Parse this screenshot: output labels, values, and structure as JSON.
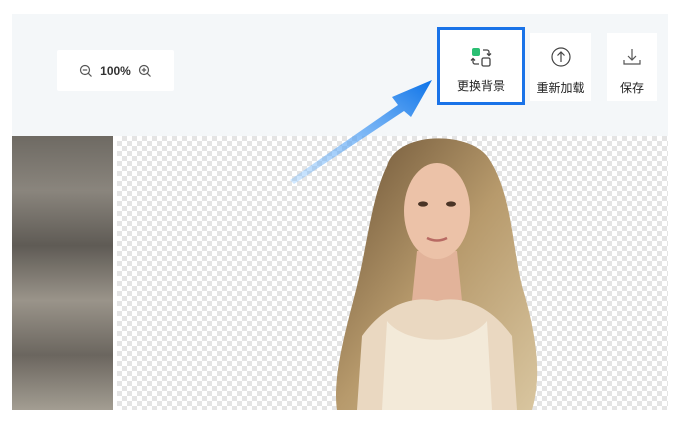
{
  "zoom": {
    "value": "100%",
    "out_icon": "zoom-out-icon",
    "in_icon": "zoom-in-icon"
  },
  "toolbar": {
    "change_background": {
      "label": "更换背景",
      "icon": "swap-background-icon"
    },
    "reload": {
      "label": "重新加载",
      "icon": "upload-circle-icon"
    },
    "save": {
      "label": "保存",
      "icon": "download-icon"
    }
  },
  "colors": {
    "highlight": "#1a73e8",
    "accent_green": "#2bbf73",
    "toolbar_bg": "#f4f7f9"
  }
}
